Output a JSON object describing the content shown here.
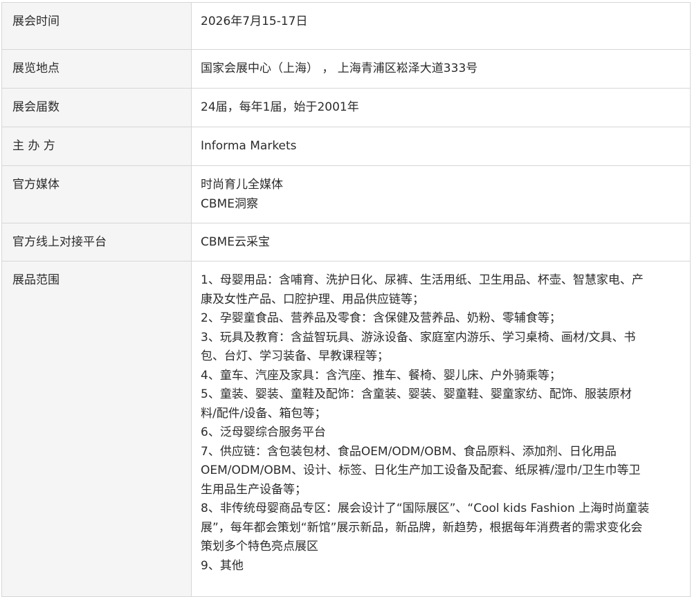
{
  "rows": {
    "time": {
      "label": "展会时间",
      "value": "2026年7月15-17日"
    },
    "place": {
      "label": "展览地点",
      "value": "国家会展中心（上海） ， 上海青浦区崧泽大道333号"
    },
    "count": {
      "label": "展会届数",
      "value": "24届，每年1届，始于2001年"
    },
    "host": {
      "label": "主 办 方",
      "value": "Informa Markets"
    },
    "media": {
      "label": "官方媒体",
      "values": [
        "时尚育儿全媒体",
        "CBME洞察"
      ]
    },
    "platform": {
      "label": "官方线上对接平台",
      "value": "CBME云采宝"
    },
    "scope": {
      "label": "展品范围",
      "lines": [
        "1、母婴用品：含哺育、洗护日化、尿裤、生活用纸、卫生用品、杯壶、智慧家电、产",
        "康及女性产品、口腔护理、用品供应链等；",
        "2、孕婴童食品、营养品及零食：含保健及营养品、奶粉、零辅食等；",
        "3、玩具及教育：含益智玩具、游泳设备、家庭室内游乐、学习桌椅、画材/文具、书",
        "包、台灯、学习装备、早教课程等；",
        "4、童车、汽座及家具：含汽座、推车、餐椅、婴儿床、户外骑乘等；",
        "5、童装、婴装、童鞋及配饰：含童装、婴装、婴童鞋、婴童家纺、配饰、服装原材",
        "料/配件/设备、箱包等；",
        "6、泛母婴综合服务平台",
        "7、供应链：含包装包材、食品OEM/ODM/OBM、食品原料、添加剂、日化用品",
        "OEM/ODM/OBM、设计、标签、日化生产加工设备及配套、纸尿裤/湿巾/卫生巾等卫",
        "生用品生产设备等；",
        "8、非传统母婴商品专区：展会设计了“国际展区”、“Cool kids Fashion 上海时尚童装",
        "展”，每年都会策划“新馆”展示新品，新品牌，新趋势，根据每年消费者的需求变化会",
        "策划多个特色亮点展区",
        "9、其他"
      ]
    }
  }
}
